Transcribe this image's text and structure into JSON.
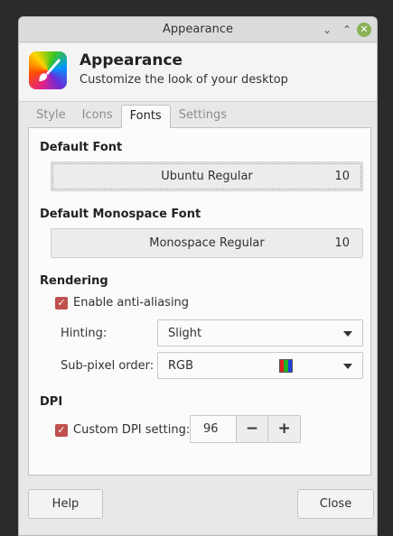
{
  "window": {
    "title": "Appearance"
  },
  "header": {
    "title": "Appearance",
    "subtitle": "Customize the look of your desktop"
  },
  "tabs": [
    {
      "label": "Style"
    },
    {
      "label": "Icons"
    },
    {
      "label": "Fonts"
    },
    {
      "label": "Settings"
    }
  ],
  "active_tab": "Fonts",
  "fonts": {
    "default_heading": "Default Font",
    "default_name": "Ubuntu Regular",
    "default_size": "10",
    "mono_heading": "Default Monospace Font",
    "mono_name": "Monospace Regular",
    "mono_size": "10"
  },
  "rendering": {
    "heading": "Rendering",
    "antialias_label": "Enable anti-aliasing",
    "antialias_checked": true,
    "hinting_label": "Hinting:",
    "hinting_value": "Slight",
    "subpixel_label": "Sub-pixel order:",
    "subpixel_value": "RGB"
  },
  "dpi": {
    "heading": "DPI",
    "custom_label": "Custom DPI setting:",
    "custom_checked": true,
    "value": "96",
    "minus": "−",
    "plus": "+"
  },
  "buttons": {
    "help": "Help",
    "close": "Close"
  },
  "icons": {
    "minimize": "minimize-icon",
    "maximize": "maximize-icon",
    "close": "close-icon",
    "app": "paintbrush-icon",
    "check": "checkmark-icon"
  },
  "colors": {
    "accent": "#c0504d",
    "close_button": "#8bb158"
  }
}
